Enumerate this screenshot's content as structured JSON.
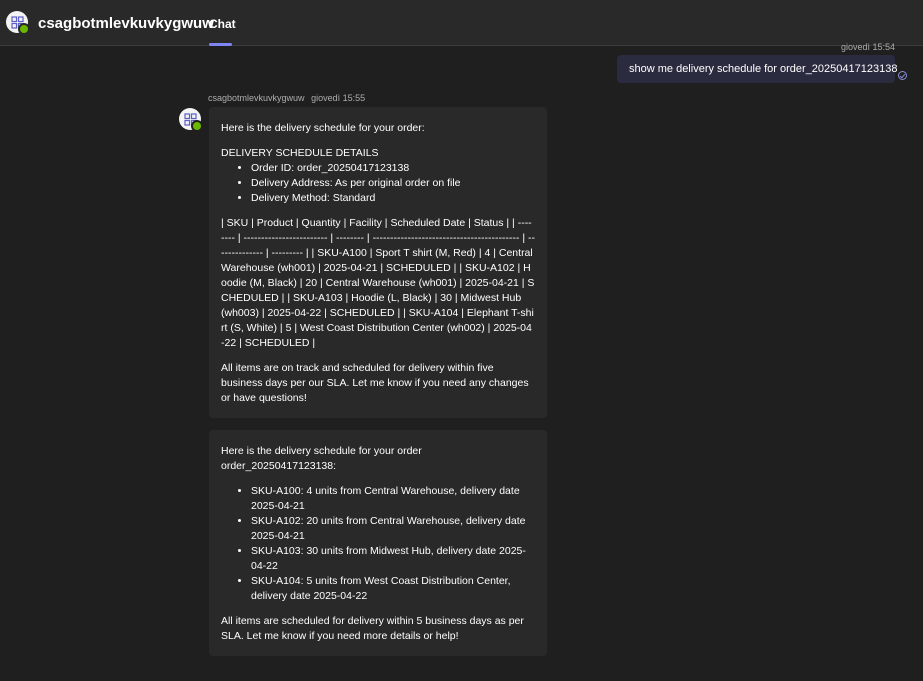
{
  "header": {
    "app_name": "csagbotmlevkuvkygwuw",
    "tab_label": "Chat"
  },
  "user_message": {
    "timestamp": "giovedì 15:54",
    "text": "show me delivery schedule for order_20250417123138"
  },
  "bot": {
    "name": "csagbotmlevkuvkygwuw",
    "timestamp": "giovedì 15:55"
  },
  "messages": [
    {
      "intro": "Here is the delivery schedule for your order:",
      "section_title": "DELIVERY SCHEDULE DETAILS",
      "details": [
        "Order ID: order_20250417123138",
        "Delivery Address: As per original order on file",
        "Delivery Method: Standard"
      ],
      "table_text": "| SKU | Product | Quantity | Facility | Scheduled Date | Status | | -------- | ------------------------ | -------- | ------------------------------------------ | -------------- | --------- | | SKU-A100 | Sport T shirt (M, Red) | 4 | Central Warehouse (wh001) | 2025-04-21 | SCHEDULED | | SKU-A102 | Hoodie (M, Black) | 20 | Central Warehouse (wh001) | 2025-04-21 | SCHEDULED | | SKU-A103 | Hoodie (L, Black) | 30 | Midwest Hub (wh003) | 2025-04-22 | SCHEDULED | | SKU-A104 | Elephant T-shirt (S, White) | 5 | West Coast Distribution Center (wh002) | 2025-04-22 | SCHEDULED |",
      "closing": "All items are on track and scheduled for delivery within five business days per our SLA. Let me know if you need any changes or have questions!"
    },
    {
      "intro": "Here is the delivery schedule for your order order_20250417123138:",
      "items": [
        "SKU-A100: 4 units from Central Warehouse, delivery date 2025-04-21",
        "SKU-A102: 20 units from Central Warehouse, delivery date 2025-04-21",
        "SKU-A103: 30 units from Midwest Hub, delivery date 2025-04-22",
        "SKU-A104: 5 units from West Coast Distribution Center, delivery date 2025-04-22"
      ],
      "closing": "All items are scheduled for delivery within 5 business days as per SLA. Let me know if you need more details or help!"
    }
  ]
}
